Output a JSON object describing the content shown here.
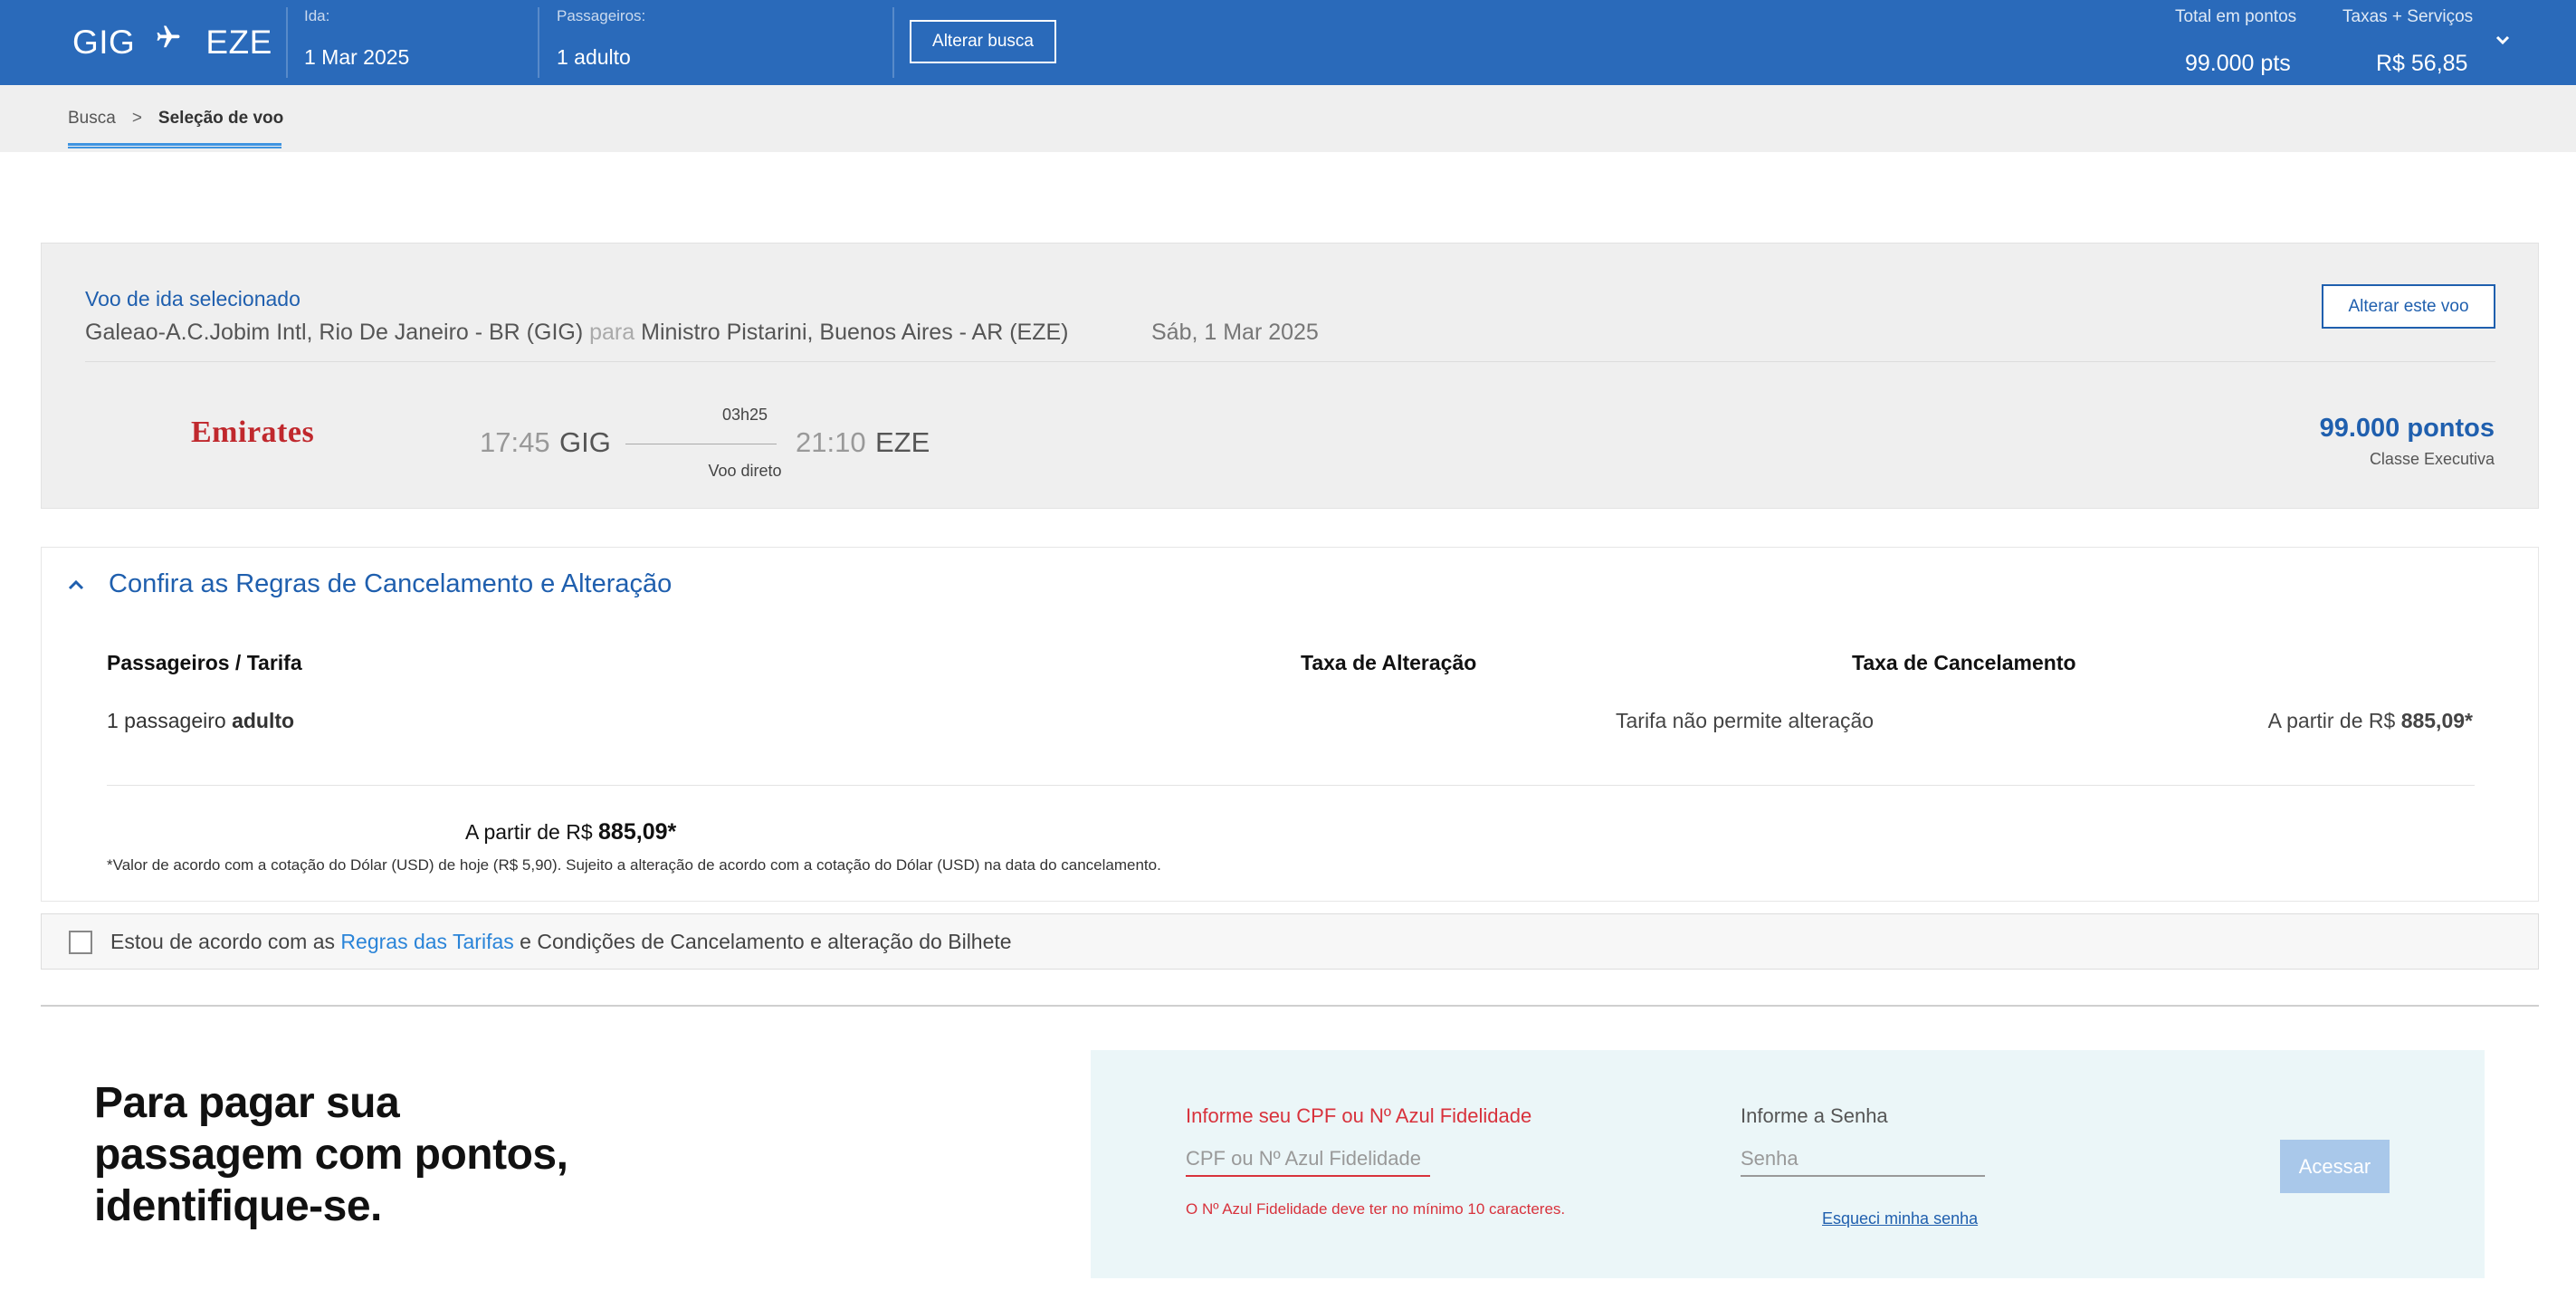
{
  "header": {
    "origin": "GIG",
    "destination": "EZE",
    "ida_label": "Ida:",
    "ida_value": "1 Mar 2025",
    "passengers_label": "Passageiros:",
    "passengers_value": "1 adulto",
    "alterar_busca": "Alterar busca",
    "total_label": "Total em pontos",
    "total_value": "99.000 pts",
    "taxes_label": "Taxas + Serviços",
    "taxes_value": "R$ 56,85"
  },
  "breadcrumb": {
    "items": [
      "Busca",
      "Seleção de voo"
    ],
    "separator": ">"
  },
  "selected_flight": {
    "label": "Voo de ida selecionado",
    "origin_airport": "Galeao-A.C.Jobim Intl, Rio De Janeiro - BR (GIG)",
    "para": "para",
    "destination_airport": "Ministro Pistarini, Buenos Aires - AR (EZE)",
    "date": "Sáb, 1 Mar 2025",
    "change_button": "Alterar este voo",
    "airline": "Emirates",
    "departure_time": "17:45",
    "departure_code": "GIG",
    "duration": "03h25",
    "stops": "Voo direto",
    "arrival_time": "21:10",
    "arrival_code": "EZE",
    "points": "99.000 pontos",
    "cabin": "Classe Executiva"
  },
  "rules": {
    "title": "Confira as Regras de Cancelamento e Alteração",
    "col_passengers": "Passageiros / Tarifa",
    "col_change_fee": "Taxa de Alteração",
    "col_cancel_fee": "Taxa de Cancelamento",
    "passenger_count": "1 passageiro",
    "passenger_type": "adulto",
    "change_fee_value": "Tarifa não permite alteração",
    "cancel_prefix": "A partir de R$",
    "cancel_value": "885,09*",
    "total_prefix": "A partir de R$",
    "total_value": "885,09*",
    "note": "*Valor de acordo com a cotação do Dólar (USD) de hoje (R$ 5,90). Sujeito a alteração de acordo com a cotação do Dólar (USD) na data do cancelamento."
  },
  "agreement": {
    "text_before": "Estou de acordo com as",
    "link": "Regras das Tarifas",
    "text_after": "e Condições de Cancelamento e alteração do Bilhete",
    "checked": false
  },
  "login": {
    "heading": "Para pagar sua passagem com pontos, identifique-se.",
    "cpf_label": "Informe seu CPF ou Nº Azul Fidelidade",
    "cpf_placeholder": "CPF ou Nº Azul Fidelidade",
    "cpf_error": "O Nº Azul Fidelidade deve ter no mínimo 10 caracteres.",
    "password_label": "Informe a Senha",
    "password_placeholder": "Senha",
    "forgot_password": "Esqueci minha senha",
    "submit": "Acessar"
  },
  "colors": {
    "header_bg": "#2a6aba",
    "link_blue": "#1f5fae",
    "error_red": "#d8323c",
    "emirates_red": "#c0282d",
    "login_bg": "#ebf6f8",
    "button_disabled": "#a9c8ea"
  },
  "icons": {
    "plane": "plane-icon",
    "chevron_down": "chevron-down-icon",
    "chevron_up": "chevron-up-icon",
    "checkbox": "checkbox-icon"
  }
}
